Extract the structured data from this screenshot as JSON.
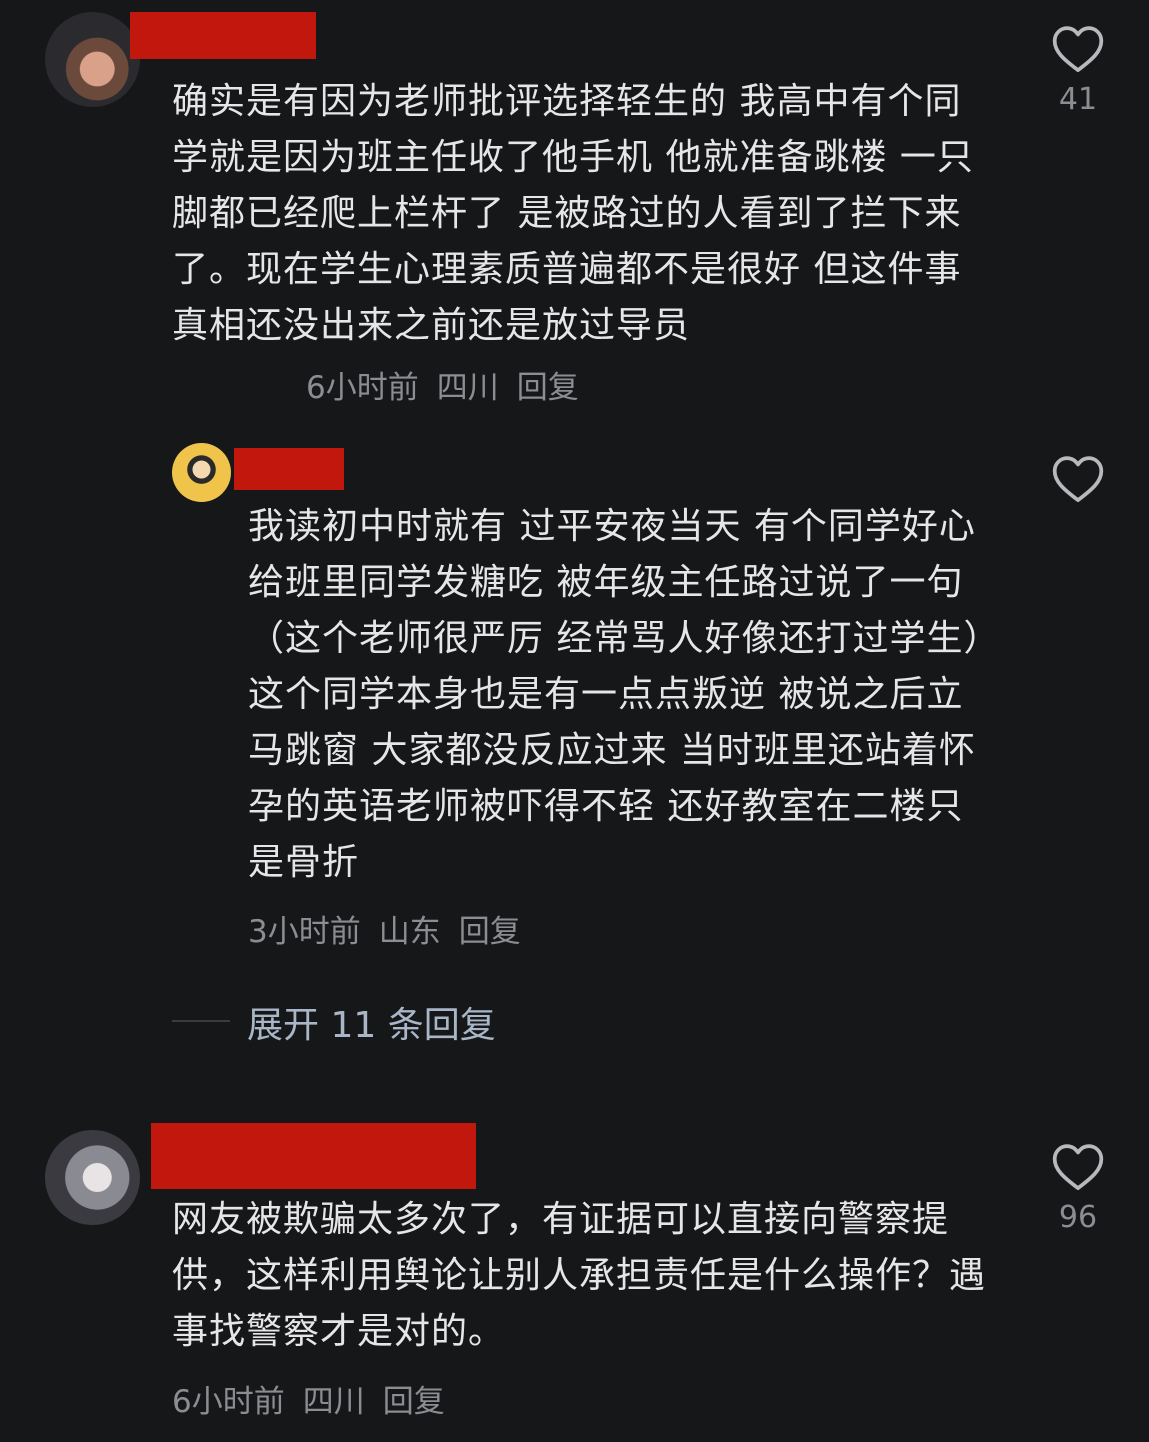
{
  "comment1": {
    "text": "确实是有因为老师批评选择轻生的 我高中有个同学就是因为班主任收了他手机 他就准备跳楼 一只脚都已经爬上栏杆了 是被路过的人看到了拦下来了。现在学生心理素质普遍都不是很好 但这件事真相还没出来之前还是放过导员",
    "time": "6小时前",
    "location": "四川",
    "reply": "回复",
    "likes": "41"
  },
  "reply1": {
    "text": "我读初中时就有 过平安夜当天 有个同学好心给班里同学发糖吃 被年级主任路过说了一句（这个老师很严厉 经常骂人好像还打过学生）这个同学本身也是有一点点叛逆 被说之后立马跳窗 大家都没反应过来 当时班里还站着怀孕的英语老师被吓得不轻 还好教室在二楼只是骨折",
    "time": "3小时前",
    "location": "山东",
    "reply": "回复"
  },
  "expand_replies": "展开 11 条回复",
  "comment2": {
    "text": "网友被欺骗太多次了，有证据可以直接向警察提供，这样利用舆论让别人承担责任是什么操作？遇事找警察才是对的。",
    "time": "6小时前",
    "location": "四川",
    "reply": "回复",
    "likes": "96"
  },
  "colors": {
    "background": "#161719",
    "redaction": "#c2170d",
    "secondary_text": "#8c8d92",
    "expand_link": "#a9b6c8"
  }
}
